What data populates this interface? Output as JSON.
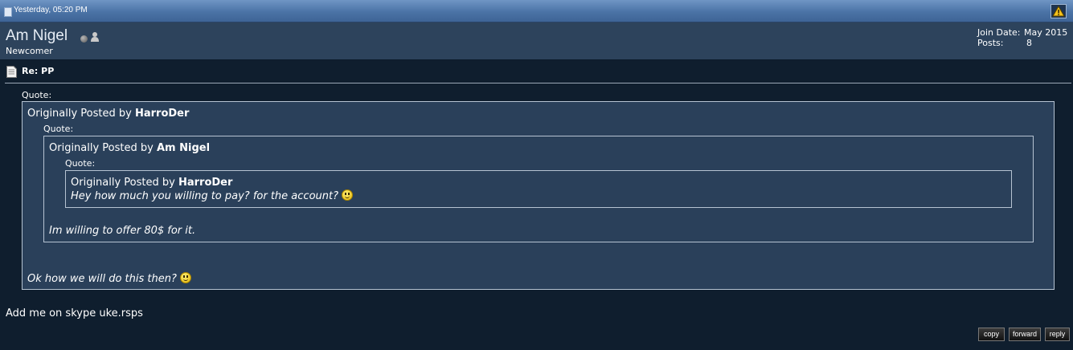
{
  "post_header": {
    "date": "Yesterday, 05:20 PM",
    "icons": {
      "date": "post-page-icon",
      "report": "warning-triangle-icon"
    }
  },
  "user": {
    "name": "Am Nigel",
    "title": "Newcomer",
    "join_date_label": "Join Date:",
    "join_date_value": "May 2015",
    "posts_label": "Posts:",
    "posts_value": "8",
    "icons": {
      "status": "offline-status-icon",
      "profile": "user-icon"
    }
  },
  "post": {
    "title": "Re: PP",
    "title_icon": "document-icon",
    "quote_label": "Quote:",
    "quote1": {
      "prefix": "Originally Posted by",
      "author": "HarroDer",
      "text": "Ok how we will do this then?"
    },
    "quote2": {
      "prefix": "Originally Posted by",
      "author": "Am Nigel",
      "text": "Im willing to offer 80$ for it."
    },
    "quote3": {
      "prefix": "Originally Posted by",
      "author": "HarroDer",
      "text": "Hey how much you willing to pay? for the account?"
    },
    "body": "Add me on skype uke.rsps"
  },
  "actions": {
    "copy": "copy",
    "forward": "forward",
    "reply": "reply"
  },
  "colors": {
    "header_blue": "#4b73a6",
    "user_bar": "#2d435c",
    "post_bg": "#0f1e2e",
    "quote_bg": "#2a405a"
  }
}
